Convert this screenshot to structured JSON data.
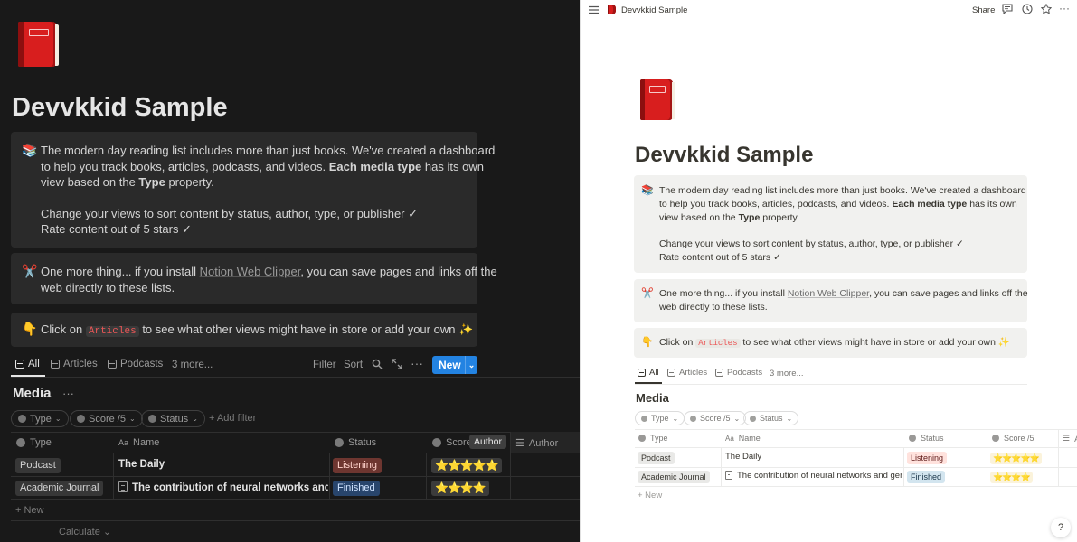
{
  "page": {
    "title": "Devvkkid Sample",
    "icon": "red-book-icon"
  },
  "callouts": [
    {
      "icon": "📚",
      "line1_before": "The modern day reading list includes more than just books. We've created a dashboard",
      "line2_before": "to help you track books, articles, podcasts, and videos.",
      "line2_bold": "Each media type",
      "line2_after": "has its own",
      "line3_before": "view based on the",
      "line3_bold": "Type",
      "line3_after": "property.",
      "line4": "Change your views to sort content by status, author, type, or publisher ✓",
      "line5": "Rate content out of 5 stars ✓"
    },
    {
      "icon": "✂️",
      "before": "One more thing... if you install",
      "link": "Notion Web Clipper",
      "after": ", you can save pages and links off the",
      "line2": "web directly to these lists."
    },
    {
      "icon": "👇",
      "before": "Click on",
      "code": "Articles",
      "after": "to see what other views might have in store or add your own ✨"
    }
  ],
  "views": {
    "tabs": [
      "All",
      "Articles",
      "Podcasts"
    ],
    "more": "3 more...",
    "filter": "Filter",
    "sort": "Sort",
    "new": "New"
  },
  "database": {
    "title": "Media",
    "more": "···",
    "chips": [
      "Type",
      "Score /5",
      "Status"
    ],
    "add_filter": "+ Add filter",
    "columns": [
      "Type",
      "Name",
      "Status",
      "Score /5",
      "Author"
    ],
    "score_short": "Score",
    "author_tooltip": "Author",
    "rows": [
      {
        "type": "Podcast",
        "name": "The Daily",
        "status": "Listening",
        "stars": "⭐⭐⭐⭐⭐",
        "stars_light": "⭐⭐⭐⭐⭐",
        "score": 5
      },
      {
        "type": "Academic Journal",
        "name": "The contribution of neural networks and gen",
        "status": "Finished",
        "stars": "⭐⭐⭐⭐",
        "stars_light": "⭐⭐⭐⭐",
        "score": 4
      }
    ],
    "new_row": "+ New",
    "calculate": "Calculate ⌄"
  },
  "topbar": {
    "breadcrumb": "Devvkkid Sample",
    "share": "Share"
  },
  "help": "?",
  "colors": {
    "accent": "#2383e2",
    "book": "#d81e1e",
    "star": "#f2c94c"
  }
}
